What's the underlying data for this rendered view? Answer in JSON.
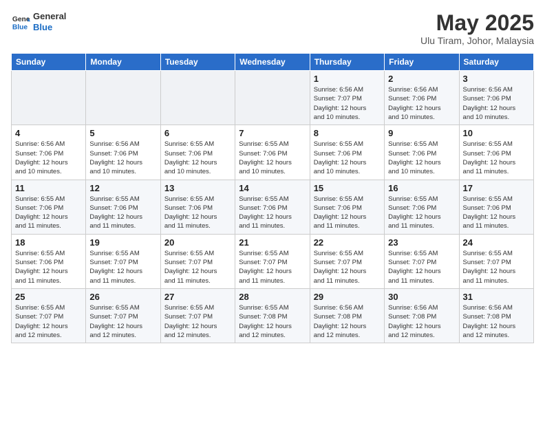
{
  "header": {
    "logo_line1": "General",
    "logo_line2": "Blue",
    "month_year": "May 2025",
    "location": "Ulu Tiram, Johor, Malaysia"
  },
  "weekdays": [
    "Sunday",
    "Monday",
    "Tuesday",
    "Wednesday",
    "Thursday",
    "Friday",
    "Saturday"
  ],
  "weeks": [
    [
      {
        "day": "",
        "info": ""
      },
      {
        "day": "",
        "info": ""
      },
      {
        "day": "",
        "info": ""
      },
      {
        "day": "",
        "info": ""
      },
      {
        "day": "1",
        "info": "Sunrise: 6:56 AM\nSunset: 7:07 PM\nDaylight: 12 hours\nand 10 minutes."
      },
      {
        "day": "2",
        "info": "Sunrise: 6:56 AM\nSunset: 7:06 PM\nDaylight: 12 hours\nand 10 minutes."
      },
      {
        "day": "3",
        "info": "Sunrise: 6:56 AM\nSunset: 7:06 PM\nDaylight: 12 hours\nand 10 minutes."
      }
    ],
    [
      {
        "day": "4",
        "info": "Sunrise: 6:56 AM\nSunset: 7:06 PM\nDaylight: 12 hours\nand 10 minutes."
      },
      {
        "day": "5",
        "info": "Sunrise: 6:56 AM\nSunset: 7:06 PM\nDaylight: 12 hours\nand 10 minutes."
      },
      {
        "day": "6",
        "info": "Sunrise: 6:55 AM\nSunset: 7:06 PM\nDaylight: 12 hours\nand 10 minutes."
      },
      {
        "day": "7",
        "info": "Sunrise: 6:55 AM\nSunset: 7:06 PM\nDaylight: 12 hours\nand 10 minutes."
      },
      {
        "day": "8",
        "info": "Sunrise: 6:55 AM\nSunset: 7:06 PM\nDaylight: 12 hours\nand 10 minutes."
      },
      {
        "day": "9",
        "info": "Sunrise: 6:55 AM\nSunset: 7:06 PM\nDaylight: 12 hours\nand 10 minutes."
      },
      {
        "day": "10",
        "info": "Sunrise: 6:55 AM\nSunset: 7:06 PM\nDaylight: 12 hours\nand 11 minutes."
      }
    ],
    [
      {
        "day": "11",
        "info": "Sunrise: 6:55 AM\nSunset: 7:06 PM\nDaylight: 12 hours\nand 11 minutes."
      },
      {
        "day": "12",
        "info": "Sunrise: 6:55 AM\nSunset: 7:06 PM\nDaylight: 12 hours\nand 11 minutes."
      },
      {
        "day": "13",
        "info": "Sunrise: 6:55 AM\nSunset: 7:06 PM\nDaylight: 12 hours\nand 11 minutes."
      },
      {
        "day": "14",
        "info": "Sunrise: 6:55 AM\nSunset: 7:06 PM\nDaylight: 12 hours\nand 11 minutes."
      },
      {
        "day": "15",
        "info": "Sunrise: 6:55 AM\nSunset: 7:06 PM\nDaylight: 12 hours\nand 11 minutes."
      },
      {
        "day": "16",
        "info": "Sunrise: 6:55 AM\nSunset: 7:06 PM\nDaylight: 12 hours\nand 11 minutes."
      },
      {
        "day": "17",
        "info": "Sunrise: 6:55 AM\nSunset: 7:06 PM\nDaylight: 12 hours\nand 11 minutes."
      }
    ],
    [
      {
        "day": "18",
        "info": "Sunrise: 6:55 AM\nSunset: 7:06 PM\nDaylight: 12 hours\nand 11 minutes."
      },
      {
        "day": "19",
        "info": "Sunrise: 6:55 AM\nSunset: 7:07 PM\nDaylight: 12 hours\nand 11 minutes."
      },
      {
        "day": "20",
        "info": "Sunrise: 6:55 AM\nSunset: 7:07 PM\nDaylight: 12 hours\nand 11 minutes."
      },
      {
        "day": "21",
        "info": "Sunrise: 6:55 AM\nSunset: 7:07 PM\nDaylight: 12 hours\nand 11 minutes."
      },
      {
        "day": "22",
        "info": "Sunrise: 6:55 AM\nSunset: 7:07 PM\nDaylight: 12 hours\nand 11 minutes."
      },
      {
        "day": "23",
        "info": "Sunrise: 6:55 AM\nSunset: 7:07 PM\nDaylight: 12 hours\nand 11 minutes."
      },
      {
        "day": "24",
        "info": "Sunrise: 6:55 AM\nSunset: 7:07 PM\nDaylight: 12 hours\nand 11 minutes."
      }
    ],
    [
      {
        "day": "25",
        "info": "Sunrise: 6:55 AM\nSunset: 7:07 PM\nDaylight: 12 hours\nand 12 minutes."
      },
      {
        "day": "26",
        "info": "Sunrise: 6:55 AM\nSunset: 7:07 PM\nDaylight: 12 hours\nand 12 minutes."
      },
      {
        "day": "27",
        "info": "Sunrise: 6:55 AM\nSunset: 7:07 PM\nDaylight: 12 hours\nand 12 minutes."
      },
      {
        "day": "28",
        "info": "Sunrise: 6:55 AM\nSunset: 7:08 PM\nDaylight: 12 hours\nand 12 minutes."
      },
      {
        "day": "29",
        "info": "Sunrise: 6:56 AM\nSunset: 7:08 PM\nDaylight: 12 hours\nand 12 minutes."
      },
      {
        "day": "30",
        "info": "Sunrise: 6:56 AM\nSunset: 7:08 PM\nDaylight: 12 hours\nand 12 minutes."
      },
      {
        "day": "31",
        "info": "Sunrise: 6:56 AM\nSunset: 7:08 PM\nDaylight: 12 hours\nand 12 minutes."
      }
    ]
  ]
}
